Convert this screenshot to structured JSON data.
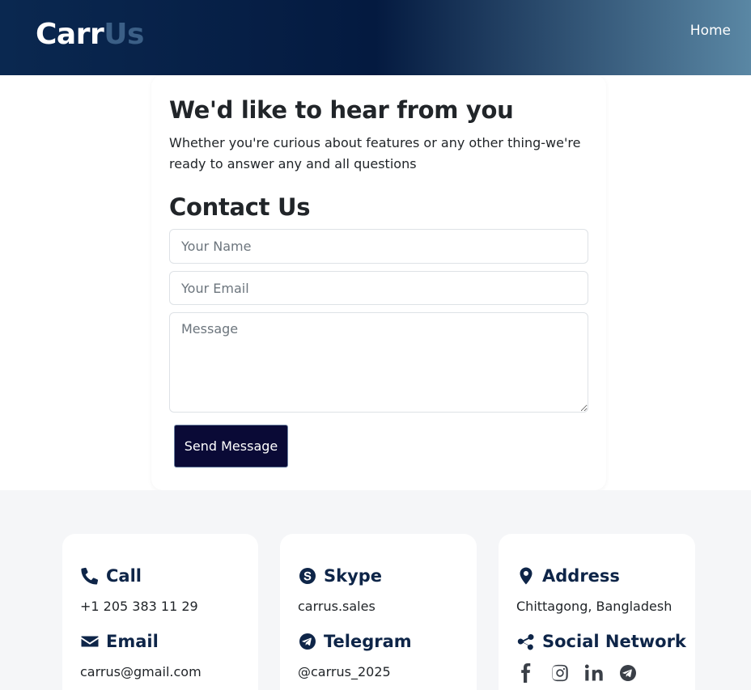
{
  "header": {
    "brand_part1": "Carr",
    "brand_part2": "Us",
    "nav_home": "Home"
  },
  "hero": {
    "title": "We'd like to hear from you",
    "subtitle": "Whether you're curious about features or any other thing-we're ready to answer any and all questions"
  },
  "contact_form": {
    "title": "Contact Us",
    "name_placeholder": "Your Name",
    "email_placeholder": "Your Email",
    "message_placeholder": "Message",
    "submit_label": "Send Message"
  },
  "info": {
    "call": {
      "label": "Call",
      "value": "+1 205 383 11 29",
      "icon": "phone-icon"
    },
    "email": {
      "label": "Email",
      "value": "carrus@gmail.com",
      "icon": "envelope-icon"
    },
    "skype": {
      "label": "Skype",
      "value": "carrus.sales",
      "icon": "skype-icon"
    },
    "telegram": {
      "label": "Telegram",
      "value": "@carrus_2025",
      "icon": "telegram-icon"
    },
    "address": {
      "label": "Address",
      "value": "Chittagong, Bangladesh",
      "icon": "map-pin-icon"
    },
    "social": {
      "label": "Social Network",
      "icon": "share-icon",
      "networks": [
        "facebook-icon",
        "instagram-icon",
        "linkedin-icon",
        "telegram-icon"
      ]
    }
  },
  "colors": {
    "brand_dark": "#041a40",
    "brand_accent": "#3b5f86",
    "button_bg": "#0a0a36",
    "heading_navy": "#0e2548",
    "section_bg": "#f5f6f8"
  }
}
